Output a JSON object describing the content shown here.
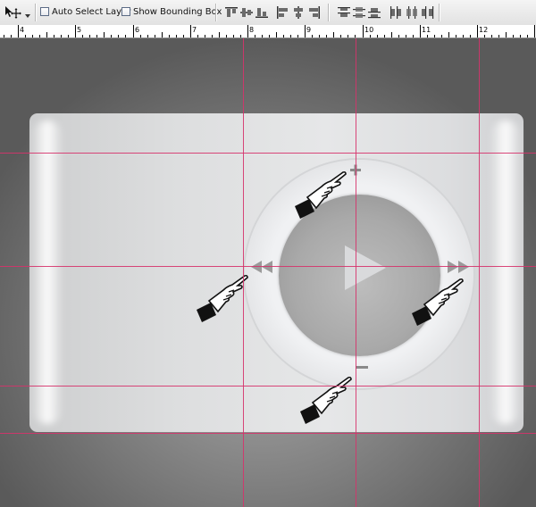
{
  "options_bar": {
    "auto_select_label": "Auto Select Layer",
    "auto_select_checked": false,
    "show_bounding_label": "Show Bounding Box",
    "show_bounding_checked": false
  },
  "ruler": {
    "numbers": [
      "4",
      "5",
      "6",
      "7",
      "8",
      "9",
      "10",
      "11",
      "12"
    ]
  },
  "icons": {
    "move_tool": "move-tool-icon",
    "align": [
      "align-top-edges-icon",
      "align-vertical-centers-icon",
      "align-bottom-edges-icon",
      "align-left-edges-icon",
      "align-horizontal-centers-icon",
      "align-right-edges-icon"
    ],
    "distribute": [
      "distribute-top-edges-icon",
      "distribute-vertical-centers-icon",
      "distribute-bottom-edges-icon",
      "distribute-left-edges-icon",
      "distribute-horizontal-centers-icon",
      "distribute-right-edges-icon"
    ],
    "player": [
      "play-icon",
      "plus-icon",
      "minus-icon",
      "rewind-icon",
      "fast-forward-icon"
    ],
    "hands": [
      "pointing-hand-icon-top",
      "pointing-hand-icon-left",
      "pointing-hand-icon-right",
      "pointing-hand-icon-bottom"
    ]
  },
  "colors": {
    "guide": "#d6336c",
    "canvas": "#6a6a6a",
    "panel": "#e2e3e4",
    "ring": "#eeeff1",
    "disc": "#a9a9a9",
    "glyph": "#8a8a8a"
  }
}
